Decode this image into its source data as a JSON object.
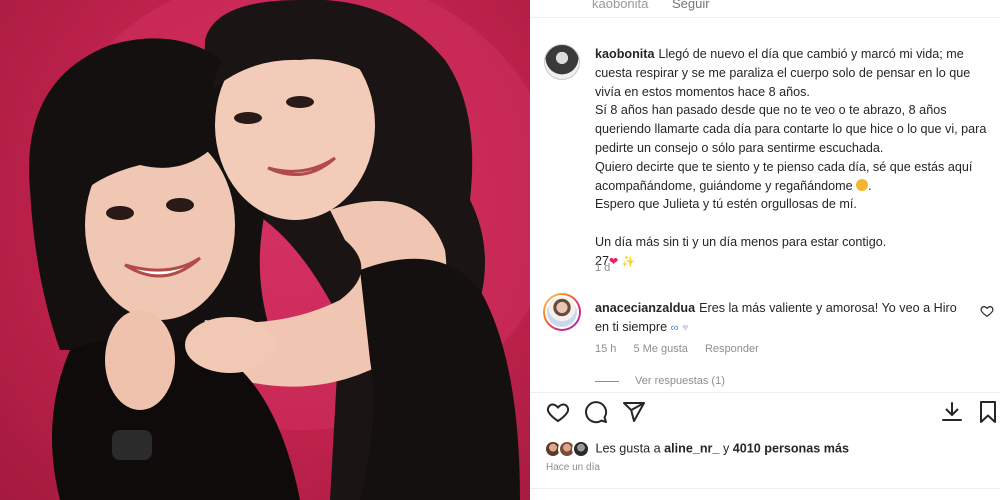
{
  "post": {
    "username": "kaobonita",
    "follow_label": "Seguir",
    "caption_lines": [
      "Llegó de nuevo el día que cambió y marcó mi vida; me cuesta respirar y se me paraliza el cuerpo solo de pensar en lo que vivía en estos momentos hace 8 años.",
      "Sí 8 años han pasado desde que no te veo o te abrazo, 8 años queriendo llamarte cada día para contarte lo que hice o lo que vi, para pedirte un consejo o sólo para sentirme escuchada.",
      "Quiero decirte que te siento y te pienso cada día, sé que estás aquí acompañándome, guiándome y regañándome",
      "Espero que Julieta y tú estén orgullosas de mí.",
      "Un día más sin ti y un día menos para estar contigo.",
      "27"
    ],
    "caption_time": "1 d",
    "emojis": {
      "face": "smiling-face-emoji",
      "heart": "heart-emoji",
      "sparkle": "sparkles-emoji"
    }
  },
  "comment": {
    "username": "anacecianzaldua",
    "text": "Eres la más valiente y amorosa! Yo veo a Hiro en ti siempre",
    "time": "15 h",
    "likes": "5 Me gusta",
    "reply_label": "Responder",
    "view_replies": "Ver respuestas (1)"
  },
  "actions": {
    "like_icon": "heart-outline-icon",
    "comment_icon": "comment-bubble-icon",
    "share_icon": "paper-plane-icon",
    "download_icon": "download-icon",
    "save_icon": "bookmark-icon"
  },
  "likes_summary": {
    "prefix": "Les gusta a",
    "first_user": "aline_nr_",
    "connector": "y",
    "others": "4010 personas más"
  },
  "posted_time": "Hace un día",
  "colors": {
    "photo_background": "#c4244f",
    "heart_red": "#e0245e",
    "meta_gray": "#8e8e8e",
    "text": "#262626"
  }
}
